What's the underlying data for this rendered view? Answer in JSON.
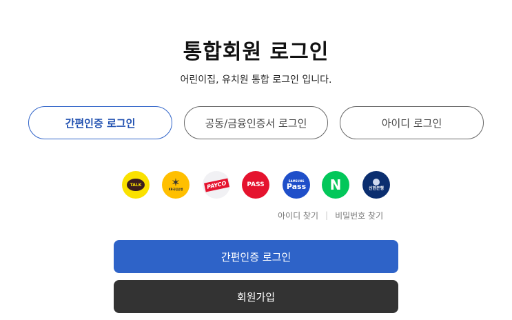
{
  "page": {
    "title": "통합회원 로그인",
    "subtitle": "어린이집, 유치원 통합 로그인 입니다."
  },
  "tabs": [
    {
      "label": "간편인증 로그인",
      "active": true
    },
    {
      "label": "공동/금융인증서 로그인",
      "active": false
    },
    {
      "label": "아이디 로그인",
      "active": false
    }
  ],
  "providers": [
    {
      "name": "kakao",
      "label": "TALK",
      "color": "#fae100"
    },
    {
      "name": "kb",
      "label": "KB국민은행",
      "color": "#ffbf00"
    },
    {
      "name": "payco",
      "label": "PAYCO",
      "color": "#e5132e"
    },
    {
      "name": "pass",
      "label": "PASS",
      "color": "#e5132e"
    },
    {
      "name": "samsung-pass",
      "label_top": "SAMSUNG",
      "label": "Pass",
      "color": "#1f4fc9"
    },
    {
      "name": "naver",
      "label": "N",
      "color": "#03c75a"
    },
    {
      "name": "shinhan",
      "label": "신한은행",
      "color": "#0b2e6f"
    }
  ],
  "links": {
    "find_id": "아이디 찾기",
    "find_password": "비밀번호 찾기"
  },
  "buttons": {
    "login": "간편인증 로그인",
    "join": "회원가입"
  },
  "colors": {
    "primary": "#2e63c8",
    "dark": "#333333"
  }
}
